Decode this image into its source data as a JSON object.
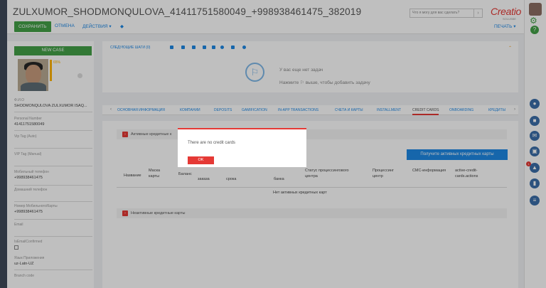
{
  "header": {
    "title": "ZULXUMOR_SHODMONQULOVA_41411751580049_+998938461475_382019",
    "save_label": "СОХРАНИТЬ",
    "cancel_label": "ОТМЕНА",
    "actions_label": "ДЕЙСТВИЯ ▾",
    "search_placeholder": "Что я могу для вас сделать?",
    "logo": "Creatio",
    "logo_sub": "SOLUSBE",
    "print_label": "ПЕЧАТЬ ▾"
  },
  "profile": {
    "new_case_label": "NEW CASE",
    "completeness": "65%",
    "fields": [
      {
        "label": "Ф.И.О",
        "value": "SHODMONQULOVA ZULXUMOR ISAQ..."
      },
      {
        "label": "Personal Number",
        "value": "41411751580049"
      },
      {
        "label": "Vip Tag (Auto)",
        "value": ""
      },
      {
        "label": "VIP Tag (Manual)",
        "value": ""
      },
      {
        "label": "Мобильный телефон",
        "value": "+998938461475"
      },
      {
        "label": "Домашний телефон",
        "value": ""
      },
      {
        "label": "Номер Мобильного/Карты",
        "value": "+998938461475"
      },
      {
        "label": "Email",
        "value": ""
      },
      {
        "label": "IsEmailConfirmed",
        "value": ""
      },
      {
        "label": "Язык Приложения",
        "value": "uz-Latn-UZ"
      },
      {
        "label": "Branch code",
        "value": ""
      }
    ]
  },
  "next_steps": {
    "label": "СЛЕДУЮЩИЕ ШАГИ (0)",
    "empty_title": "У вас еще нет задач",
    "empty_hint": "Нажмите ⚐ выше, чтобы добавить задачу"
  },
  "tabs": [
    "ОСНОВНАЯ ИНФОРМАЦИЯ",
    "КОМПАНИИ",
    "DEPOSITS",
    "GAMIFICATION",
    "IN-APP TRANSACTIONS",
    "СЧЕТА И КАРТЫ",
    "INSTALLMENT",
    "CREDIT CARDS",
    "ONBOARDING",
    "КРЕДИТЫ"
  ],
  "credit": {
    "active_section": "Активные кредитные к",
    "get_button": "Получите активных кредитных карты",
    "columns": [
      "Название",
      "Маска карты",
      "Баланс",
      "заказа",
      "срока",
      "банка",
      "Статус процессингового центра",
      "Процессинг центр",
      "СМС-информация",
      "active-credit-cards.actions"
    ],
    "empty_text": "Нет активных кредитных карт",
    "inactive_section": "Неактивные кредитные карты"
  },
  "dialog": {
    "message": "There are no credit cards",
    "ok_label": "OK"
  },
  "rightbar": {
    "notification_count": "1"
  }
}
